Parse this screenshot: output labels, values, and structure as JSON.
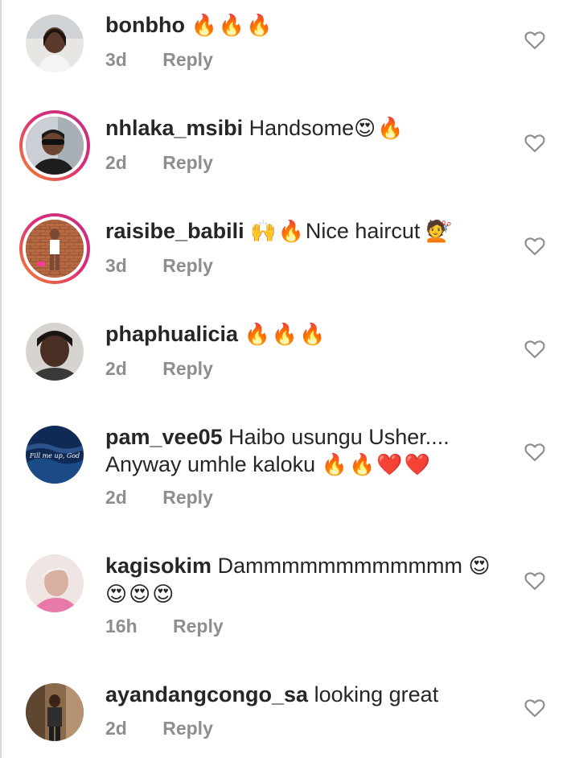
{
  "comments": [
    {
      "username": "bonbho",
      "text": "",
      "emoji": "🔥🔥🔥",
      "time": "3d",
      "reply": "Reply"
    },
    {
      "username": "nhlaka_msibi",
      "text": "Handsome",
      "emoji": "😍🔥",
      "time": "2d",
      "reply": "Reply"
    },
    {
      "username": "raisibe_babili",
      "text": "Nice haircut",
      "emoji_before": "🙌🔥",
      "emoji": "💇",
      "time": "3d",
      "reply": "Reply"
    },
    {
      "username": "phaphualicia",
      "text": "",
      "emoji": "🔥🔥🔥",
      "time": "2d",
      "reply": "Reply"
    },
    {
      "username": "pam_vee05",
      "text": "Haibo usungu Usher.... Anyway umhle kaloku",
      "emoji": "🔥🔥❤️❤️",
      "avatar_text": "Fill me up, God",
      "time": "2d",
      "reply": "Reply"
    },
    {
      "username": "kagisokim",
      "text": "Dammmmmmmmmmmm",
      "emoji": "😍😍😍😍",
      "time": "16h",
      "reply": "Reply"
    },
    {
      "username": "ayandangcongo_sa",
      "text": "looking great",
      "emoji": "",
      "time": "2d",
      "reply": "Reply"
    }
  ],
  "icons": {
    "like": "heart-outline-icon"
  },
  "colors": {
    "text": "#262626",
    "meta": "#8e8e8e",
    "icon": "#8e8e8e",
    "story_ring_start": "#f58529",
    "story_ring_end": "#c0337e"
  }
}
